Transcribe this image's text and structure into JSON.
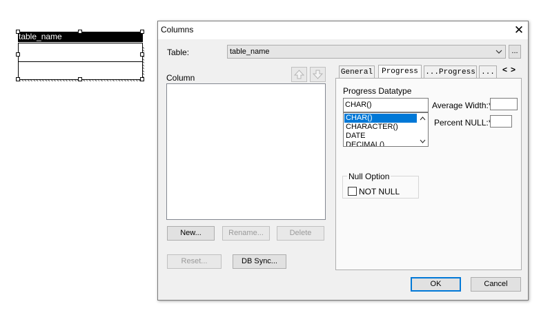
{
  "canvas": {
    "table_title": "table_name"
  },
  "dialog": {
    "title": "Columns",
    "close_glyph": "✕",
    "table_label": "Table:",
    "table_value": "table_name",
    "browse_label": "...",
    "column_label": "Column",
    "buttons": {
      "new": "New...",
      "rename": "Rename...",
      "delete": "Delete",
      "reset": "Reset...",
      "db_sync": "DB Sync...",
      "ok": "OK",
      "cancel": "Cancel"
    },
    "tabs": [
      {
        "label": "General"
      },
      {
        "label": "Progress"
      },
      {
        "label": "...Progress"
      },
      {
        "label": "..."
      }
    ],
    "tab_scroll": {
      "left": "<",
      "right": ">"
    },
    "progress": {
      "datatype_label": "Progress Datatype",
      "datatype_value": "CHAR()",
      "datatype_options": [
        "CHAR()",
        "CHARACTER()",
        "DATE",
        "DECIMAL()"
      ],
      "selected_option": "CHAR()",
      "average_width_label": "Average Width:*",
      "average_width_value": "",
      "percent_null_label": "Percent NULL:*",
      "percent_null_value": "",
      "null_option_label": "Null Option",
      "not_null_label": "NOT NULL",
      "not_null_checked": false
    }
  }
}
